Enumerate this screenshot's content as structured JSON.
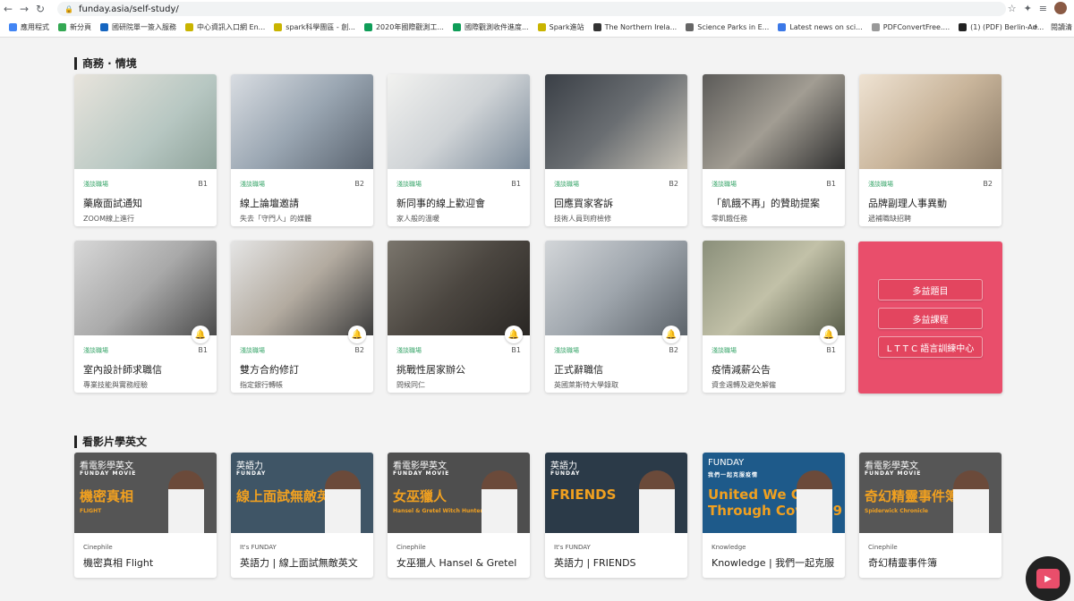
{
  "browser": {
    "url": "funday.asia/self-study/",
    "bookmarks": [
      {
        "label": "應用程式",
        "color": "#4285f4"
      },
      {
        "label": "新分頁",
        "color": "#34a853"
      },
      {
        "label": "國研院單一簽入服務",
        "color": "#1565c0"
      },
      {
        "label": "中心資訊入口網 En...",
        "color": "#c9b400"
      },
      {
        "label": "spark科學團區 - 創...",
        "color": "#c9b400"
      },
      {
        "label": "2020年國際觀測工...",
        "color": "#0f9d58"
      },
      {
        "label": "國際觀測收件進度...",
        "color": "#0f9d58"
      },
      {
        "label": "Spark進站",
        "color": "#c9b400"
      },
      {
        "label": "The Northern Irela...",
        "color": "#333333"
      },
      {
        "label": "Science Parks in E...",
        "color": "#666666"
      },
      {
        "label": "Latest news on sci...",
        "color": "#3b78e7"
      },
      {
        "label": "PDFConvertFree....",
        "color": "#999999"
      },
      {
        "label": "(1) (PDF) Berlin-Ad...",
        "color": "#222222"
      }
    ],
    "more": "»",
    "reading_list": "閱讀清"
  },
  "sections": {
    "business": {
      "title": "商務 · 情境",
      "cards": [
        {
          "tag": "淺談職場",
          "level": "B1",
          "title": "藥廠面試通知",
          "sub": "ZOOM線上進行",
          "bell": false
        },
        {
          "tag": "淺談職場",
          "level": "B2",
          "title": "線上論壇邀請",
          "sub": "失去「守門人」的媒體",
          "bell": false
        },
        {
          "tag": "淺談職場",
          "level": "B1",
          "title": "新同事的線上歡迎會",
          "sub": "家人般的溫暖",
          "bell": false
        },
        {
          "tag": "淺談職場",
          "level": "B2",
          "title": "回應買家客訴",
          "sub": "技術人員到府檢修",
          "bell": false
        },
        {
          "tag": "淺談職場",
          "level": "B1",
          "title": "「飢餓不再」的贊助提案",
          "sub": "零飢餓任務",
          "bell": false
        },
        {
          "tag": "淺談職場",
          "level": "B2",
          "title": "品牌副理人事異動",
          "sub": "遞補職缺招聘",
          "bell": false
        },
        {
          "tag": "淺談職場",
          "level": "B1",
          "title": "室內設計師求職信",
          "sub": "專業技能與實務經驗",
          "bell": true
        },
        {
          "tag": "淺談職場",
          "level": "B2",
          "title": "雙方合約修訂",
          "sub": "指定銀行轉帳",
          "bell": true
        },
        {
          "tag": "淺談職場",
          "level": "B1",
          "title": "挑戰性居家辦公",
          "sub": "問候同仁",
          "bell": true
        },
        {
          "tag": "淺談職場",
          "level": "B2",
          "title": "正式辭職信",
          "sub": "英國萊斯特大學錄取",
          "bell": true
        },
        {
          "tag": "淺談職場",
          "level": "B1",
          "title": "疫情減薪公告",
          "sub": "資金週轉及避免解僱",
          "bell": true
        }
      ],
      "links": [
        "多益題目",
        "多益課程",
        "L T T C 語言訓練中心"
      ]
    },
    "movies": {
      "title": "看影片學英文",
      "cards": [
        {
          "cat": "Cinephile",
          "title": "機密真相 Flight",
          "head": "看電影學英文",
          "sub": "FUNDAY MOVIE",
          "big": "機密真相",
          "en": "FLIGHT"
        },
        {
          "cat": "It's FUNDAY",
          "title": "英語力 | 線上面試無敵英文",
          "head": "英語力",
          "sub": "FUNDAY",
          "big": "線上面試無敵英文",
          "en": ""
        },
        {
          "cat": "Cinephile",
          "title": "女巫獵人 Hansel & Gretel",
          "head": "看電影學英文",
          "sub": "FUNDAY MOVIE",
          "big": "女巫獵人",
          "en": "Hansel & Gretel Witch Hunter"
        },
        {
          "cat": "It's FUNDAY",
          "title": "英語力 | FRIENDS",
          "head": "英語力",
          "sub": "FUNDAY",
          "big": "FRIENDS",
          "en": ""
        },
        {
          "cat": "Knowledge",
          "title": "Knowledge | 我們一起克服",
          "head": "FUNDAY",
          "sub": "我們一起克服疫情",
          "big": "United We Get Through Covid-19",
          "en": ""
        },
        {
          "cat": "Cinephile",
          "title": "奇幻精靈事件簿",
          "head": "看電影學英文",
          "sub": "FUNDAY MOVIE",
          "big": "奇幻精靈事件簿",
          "en": "Spiderwick Chronicle"
        }
      ]
    }
  },
  "colors": {
    "accent_pink": "#e94e6b",
    "tag_green": "#3aa66b",
    "bell_yellow": "#f0b400"
  }
}
